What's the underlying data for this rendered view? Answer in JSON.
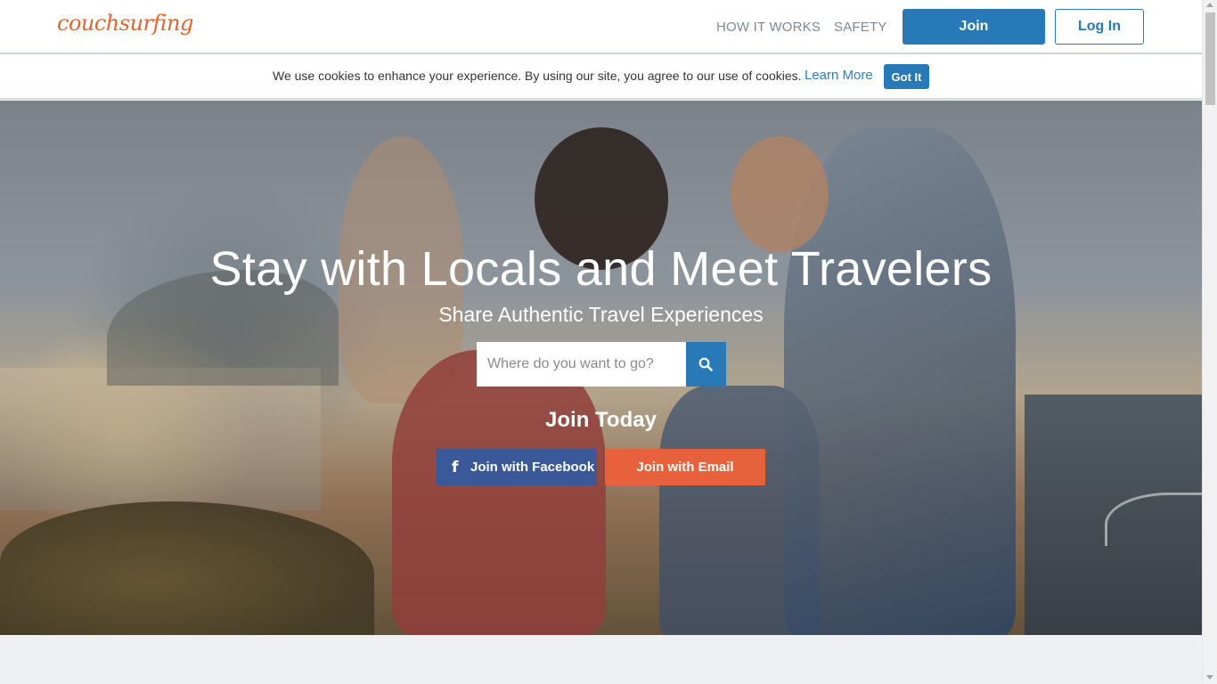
{
  "header": {
    "logo_text": "couchsurfing",
    "nav": {
      "how_it_works": "HOW IT WORKS",
      "safety": "SAFETY"
    },
    "join_label": "Join",
    "login_label": "Log In"
  },
  "cookie_bar": {
    "message": "We use cookies to enhance your experience. By using our site, you agree to our use of cookies.",
    "learn_more": "Learn More",
    "got_it": "Got It"
  },
  "hero": {
    "title": "Stay with Locals and Meet Travelers",
    "subtitle": "Share Authentic Travel Experiences",
    "search": {
      "placeholder": "Where do you want to go?",
      "icon": "search-icon"
    },
    "join_today": "Join Today",
    "facebook_button": "Join with Facebook",
    "facebook_icon": "f",
    "email_button": "Join with Email"
  },
  "colors": {
    "brand_orange": "#e2652f",
    "primary_blue": "#2779b8",
    "facebook_blue": "#3b5998",
    "email_orange": "#e8613d"
  }
}
